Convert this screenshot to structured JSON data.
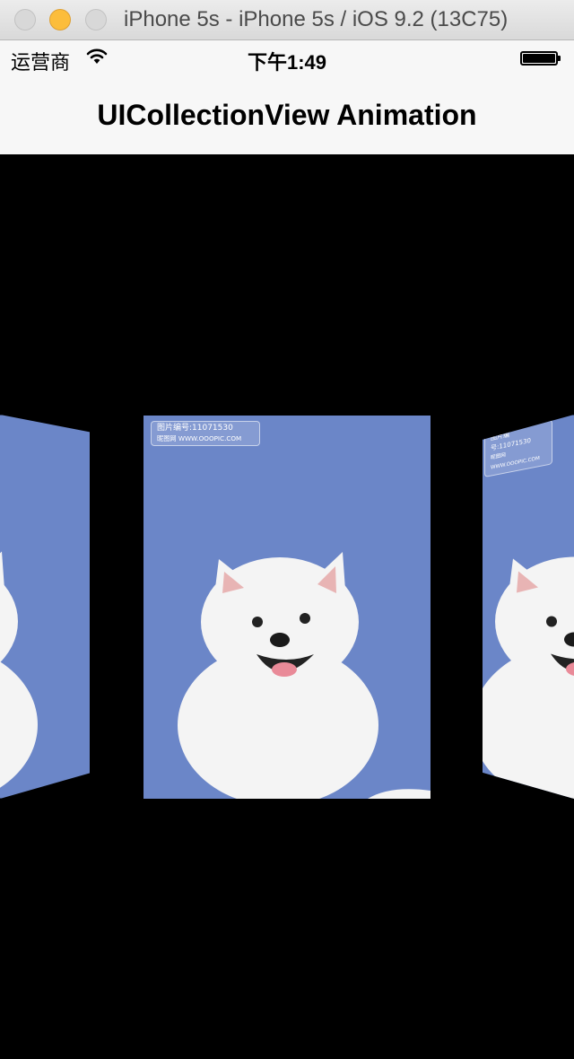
{
  "window": {
    "title": "iPhone 5s - iPhone 5s / iOS 9.2 (13C75)"
  },
  "status_bar": {
    "carrier": "运营商",
    "time": "下午1:49",
    "battery_level": 1.0
  },
  "nav_bar": {
    "title": "UICollectionView Animation"
  },
  "collection": {
    "cards": [
      {
        "position": "left",
        "image": "white-puppy-photo"
      },
      {
        "position": "center",
        "image": "white-puppy-photo",
        "watermark_line1": "图片编号:11071530",
        "watermark_line2": "昵图网 WWW.OOOPIC.COM"
      },
      {
        "position": "right",
        "image": "white-puppy-photo",
        "watermark_line1": "图片编号:11071530",
        "watermark_line2": "昵图网 WWW.OOOPIC.COM"
      }
    ]
  },
  "colors": {
    "sky": "#6b86c8",
    "fur": "#f4f4f4",
    "nav_bg": "#f7f7f7",
    "content_bg": "#000000",
    "minimize": "#fcbd3b"
  }
}
